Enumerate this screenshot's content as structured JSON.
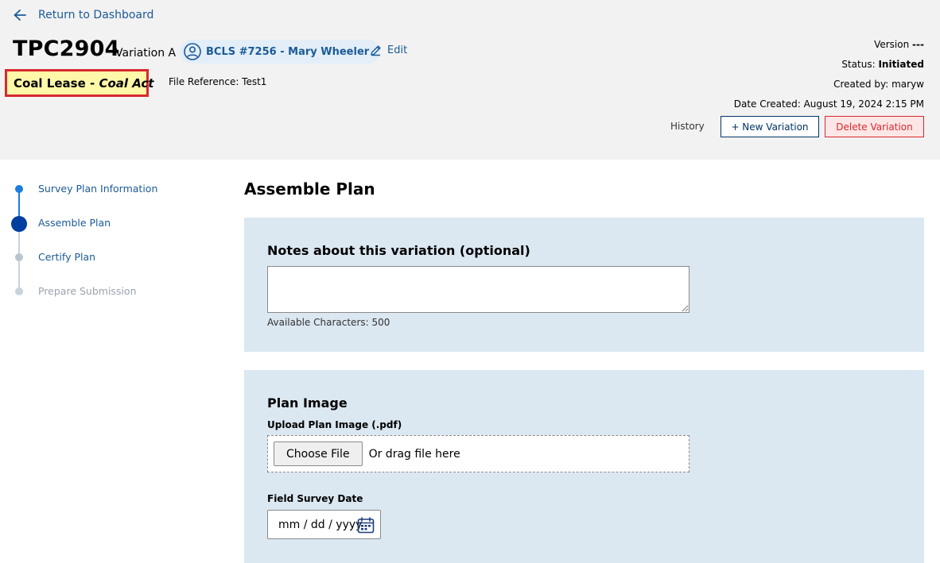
{
  "nav": {
    "back_label": "Return to Dashboard"
  },
  "plan": {
    "id": "TPC2904",
    "variation": "Variation A",
    "user_chip": "BCLS #7256 - Mary Wheeler",
    "edit_label": "Edit",
    "type_label": "Coal Lease - ",
    "act_label": "Coal Act",
    "file_reference": "File Reference: Test1"
  },
  "meta": {
    "version_label": "Version",
    "version_value": "---",
    "status_label": "Status:",
    "status_value": "Initiated",
    "created_by_label": "Created by:",
    "created_by_value": "maryw",
    "date_created_label": "Date Created:",
    "date_created_value": "August 19, 2024 2:15 PM"
  },
  "actions": {
    "history": "History",
    "new_variation": "+ New Variation",
    "delete_variation": "Delete Variation"
  },
  "steps": [
    {
      "label": "Survey Plan Information",
      "state": "completed"
    },
    {
      "label": "Assemble Plan",
      "state": "current"
    },
    {
      "label": "Certify Plan",
      "state": "upcoming"
    },
    {
      "label": "Prepare Submission",
      "state": "disabled"
    }
  ],
  "main": {
    "title": "Assemble Plan",
    "notes": {
      "heading": "Notes about this variation (optional)",
      "value": "",
      "available": "Available Characters: 500"
    },
    "plan_image": {
      "heading": "Plan Image",
      "upload_label": "Upload Plan Image (.pdf)",
      "choose_button": "Choose File",
      "drag_text": "Or drag file here",
      "survey_date_label": "Field Survey Date",
      "date_placeholder": "mm / dd / yyyy"
    }
  },
  "colors": {
    "link_blue": "#1a5a96",
    "step_active": "#003ea0",
    "step_done": "#1e7be0",
    "danger": "#d8292f",
    "badge_bg": "#fff8a8",
    "panel_bg": "#dbe7f1",
    "header_bg": "#f2f2f2"
  },
  "icons": {
    "back": "arrow-left-icon",
    "user": "user-circle-icon",
    "edit": "pencil-icon",
    "calendar": "calendar-icon"
  }
}
